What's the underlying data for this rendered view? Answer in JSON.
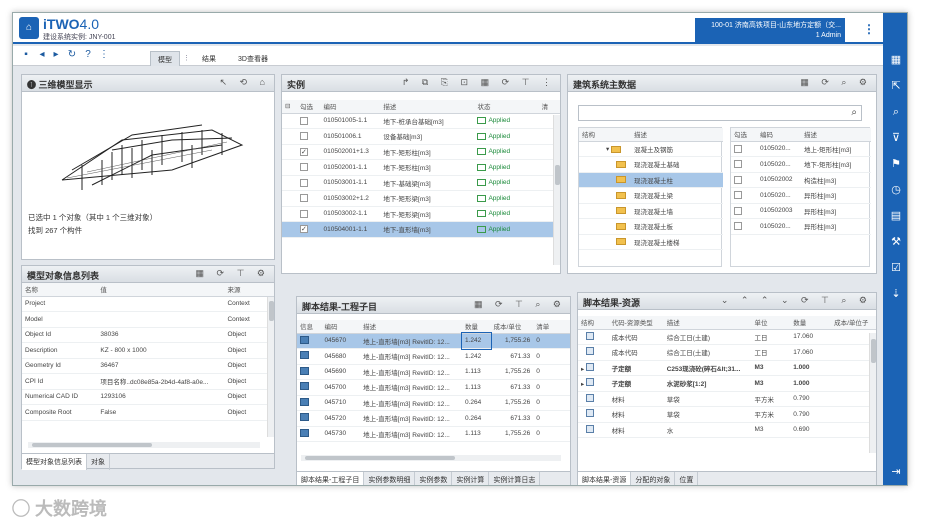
{
  "app": {
    "brand": "iTWO",
    "version": "4.0",
    "subtitle": "建设系统实例: JNY-001",
    "project_line1": "100-01 济南高铁项目-山东地方定额（交...",
    "project_line2": "1 Admin",
    "menu_icon": "kebab-icon"
  },
  "toolbar": {
    "tabs": [
      "模型",
      "结果",
      "3D查看器"
    ],
    "active_tab": "模型"
  },
  "panel_3d": {
    "title": "三维模型显示",
    "selection_text": "已选中 1 个对象（其中 1 个三维对象）",
    "found_text": "找到 267 个构件"
  },
  "panel_instances": {
    "title": "实例",
    "columns": [
      "勾选",
      "编码",
      "描述",
      "状态",
      "清"
    ],
    "rows": [
      {
        "checked": false,
        "code": "010501005-1.1",
        "desc": "地下-桩承台基础[m3]",
        "status": "Applied"
      },
      {
        "checked": false,
        "code": "010501006.1",
        "desc": "设备基础[m3]",
        "status": "Applied"
      },
      {
        "checked": true,
        "code": "010502001+1.3",
        "desc": "地下-矩形柱[m3]",
        "status": "Applied"
      },
      {
        "checked": false,
        "code": "010502001-1.1",
        "desc": "地下-矩形柱[m3]",
        "status": "Applied"
      },
      {
        "checked": false,
        "code": "010503001-1.1",
        "desc": "地下-基础梁[m3]",
        "status": "Applied"
      },
      {
        "checked": false,
        "code": "010503002+1.2",
        "desc": "地下-矩形梁[m3]",
        "status": "Applied"
      },
      {
        "checked": false,
        "code": "010503002-1.1",
        "desc": "地下-矩形梁[m3]",
        "status": "Applied"
      },
      {
        "checked": true,
        "code": "010504001-1.1",
        "desc": "地下-直形墙[m3]",
        "status": "Applied"
      }
    ]
  },
  "panel_building": {
    "title": "建筑系统主数据",
    "left_cols": [
      "结构",
      "描述"
    ],
    "tree": [
      "混凝土及钢筋",
      "现浇混凝土基础",
      "现浇混凝土柱",
      "现浇混凝土梁",
      "现浇混凝土墙",
      "现浇混凝土板",
      "现浇混凝土楼梯"
    ],
    "right_cols": [
      "勾选",
      "编码",
      "描述"
    ],
    "right_rows": [
      {
        "code": "0105020...",
        "desc": "地上-矩形柱[m3]"
      },
      {
        "code": "0105020...",
        "desc": "地下-矩形柱[m3]"
      },
      {
        "code": "010502002",
        "desc": "构造柱[m3]"
      },
      {
        "code": "0105020...",
        "desc": "异形柱[m3]"
      },
      {
        "code": "010502003",
        "desc": "异形柱[m3]"
      },
      {
        "code": "0105020...",
        "desc": "异形柱[m3]"
      }
    ]
  },
  "panel_objinfo": {
    "title": "模型对象信息列表",
    "columns": [
      "名称",
      "值",
      "来源"
    ],
    "rows": [
      {
        "name": "Project",
        "value": "",
        "src": "Context"
      },
      {
        "name": "Model",
        "value": "",
        "src": "Context"
      },
      {
        "name": "Object Id",
        "value": "38036",
        "src": "Object"
      },
      {
        "name": "Description",
        "value": "KZ - 800 x 1000",
        "src": "Object"
      },
      {
        "name": "Geometry Id",
        "value": "36467",
        "src": "Object"
      },
      {
        "name": "CPI Id",
        "value": "项目名称..dc08e85a-2b4d-4af8-a0e...",
        "src": "Object"
      },
      {
        "name": "Numerical CAD ID",
        "value": "1293106",
        "src": "Object"
      },
      {
        "name": "Composite Root",
        "value": "False",
        "src": "Object"
      }
    ],
    "tabs": [
      "模型对象信息列表",
      "对象"
    ]
  },
  "panel_script": {
    "title": "脚本结果-工程子目",
    "columns": [
      "信息",
      "编码",
      "描述",
      "数量",
      "成本/单位",
      "清单"
    ],
    "rows": [
      {
        "code": "045670",
        "desc": "地上-直形墙[m3] RevitID: 12...",
        "qty": "1.242",
        "unit": "1,755.26",
        "c": "0"
      },
      {
        "code": "045680",
        "desc": "地上-直形墙[m3] RevitID: 12...",
        "qty": "1.242",
        "unit": "671.33",
        "c": "0"
      },
      {
        "code": "045690",
        "desc": "地上-直形墙[m3] RevitID: 12...",
        "qty": "1.113",
        "unit": "1,755.26",
        "c": "0"
      },
      {
        "code": "045700",
        "desc": "地上-直形墙[m3] RevitID: 12...",
        "qty": "1.113",
        "unit": "671.33",
        "c": "0"
      },
      {
        "code": "045710",
        "desc": "地上-直形墙[m3] RevitID: 12...",
        "qty": "0.264",
        "unit": "1,755.26",
        "c": "0"
      },
      {
        "code": "045720",
        "desc": "地上-直形墙[m3] RevitID: 12...",
        "qty": "0.264",
        "unit": "671.33",
        "c": "0"
      },
      {
        "code": "045730",
        "desc": "地上-直形墙[m3] RevitID: 12...",
        "qty": "1.113",
        "unit": "1,755.26",
        "c": "0"
      }
    ],
    "tabs": [
      "脚本结果-工程子目",
      "实例参数明细",
      "实例参数",
      "实例计算",
      "实例计算日志"
    ]
  },
  "panel_resource": {
    "title": "脚本结果-资源",
    "columns": [
      "结构",
      "代码-资源类型",
      "描述",
      "单位",
      "数量",
      "成本/单位子"
    ],
    "rows": [
      {
        "type": "成本代码",
        "desc": "综合工日(土建)",
        "unit": "工日",
        "qty": "17.060",
        "bold": false,
        "exp": false
      },
      {
        "type": "成本代码",
        "desc": "综合工日(土建)",
        "unit": "工日",
        "qty": "17.060",
        "bold": false,
        "exp": false
      },
      {
        "type": "子定额",
        "desc": "C253现浇砼(碎石&lt;31...",
        "unit": "M3",
        "qty": "1.000",
        "bold": true,
        "exp": true
      },
      {
        "type": "子定额",
        "desc": "水泥砂浆[1:2]",
        "unit": "M3",
        "qty": "1.000",
        "bold": true,
        "exp": true
      },
      {
        "type": "材料",
        "desc": "草袋",
        "unit": "平方米",
        "qty": "0.790",
        "bold": false,
        "exp": false
      },
      {
        "type": "材料",
        "desc": "草袋",
        "unit": "平方米",
        "qty": "0.790",
        "bold": false,
        "exp": false
      },
      {
        "type": "材料",
        "desc": "水",
        "unit": "M3",
        "qty": "0.690",
        "bold": false,
        "exp": false
      }
    ],
    "tabs": [
      "脚本结果-资源",
      "分配的对象",
      "位置"
    ]
  },
  "watermark": "大数跨境"
}
